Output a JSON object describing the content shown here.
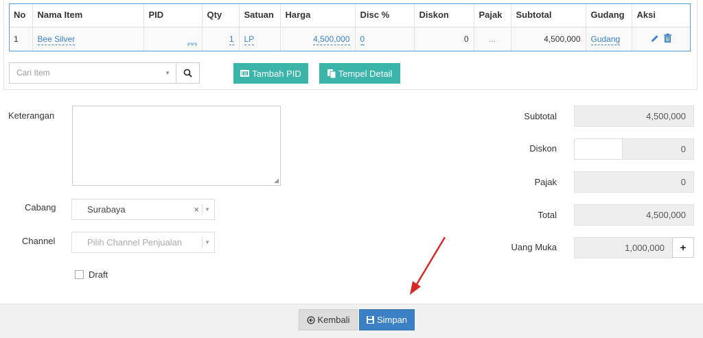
{
  "table": {
    "headers": [
      "No",
      "Nama Item",
      "PID",
      "Qty",
      "Satuan",
      "Harga",
      "Disc %",
      "Diskon",
      "Pajak",
      "Subtotal",
      "Gudang",
      "Aksi"
    ],
    "row": {
      "no": "1",
      "nama_item": "Bee Silver",
      "pid": "__",
      "qty": "1",
      "satuan": "LP",
      "harga": "4,500,000",
      "disc_pct": "0",
      "diskon": "0",
      "pajak": "...",
      "subtotal": "4,500,000",
      "gudang": "Gudang"
    }
  },
  "search": {
    "placeholder": "Cari Item"
  },
  "buttons": {
    "tambah_pid": "Tambah PID",
    "tempel_detail": "Tempel Detail",
    "kembali": "Kembali",
    "simpan": "Simpan",
    "plus": "+"
  },
  "form": {
    "keterangan_label": "Keterangan",
    "cabang_label": "Cabang",
    "cabang_value": "Surabaya",
    "channel_label": "Channel",
    "channel_placeholder": "Pilih Channel Penjualan",
    "draft_label": "Draft"
  },
  "summary": {
    "subtotal_label": "Subtotal",
    "subtotal_value": "4,500,000",
    "diskon_label": "Diskon",
    "diskon_value": "0",
    "pajak_label": "Pajak",
    "pajak_value": "0",
    "total_label": "Total",
    "total_value": "4,500,000",
    "uang_muka_label": "Uang Muka",
    "uang_muka_value": "1,000,000"
  },
  "colors": {
    "primary": "#3a7fc4",
    "teal": "#3bb4a9",
    "annotation_arrow": "#d42a2a"
  }
}
